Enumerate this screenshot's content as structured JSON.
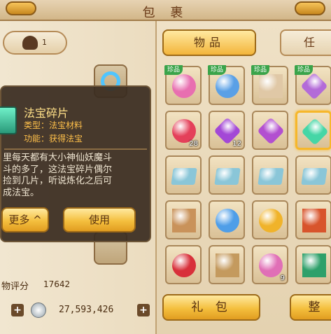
{
  "header": {
    "title": "包 裹"
  },
  "left": {
    "char_level": "1",
    "score_label": "物评分",
    "score_value": "17642",
    "money": "27,593,426",
    "plus_symbol": "+"
  },
  "tooltip": {
    "name": "法宝碎片",
    "type": "类型：法宝材料",
    "function": "功能：获得法宝",
    "description_lines": [
      "里每天都有大小神仙妖魔斗",
      "斗的多了，这法宝碎片偶尔",
      "捡到几片，听说炼化之后可",
      "成法宝。"
    ],
    "more_button": "更多 ^",
    "use_button": "使用"
  },
  "right": {
    "tabs": [
      {
        "label": "物品"
      },
      {
        "label": "任"
      }
    ],
    "rare_badge": "珍品",
    "items": [
      {
        "icon": "flower-wreath",
        "color": "#e86fb0",
        "rare": true,
        "count": ""
      },
      {
        "icon": "blue-necklace",
        "color": "#5aa0e6",
        "rare": true,
        "count": ""
      },
      {
        "icon": "shell-charm",
        "color": "#e0c8a6",
        "rare": true,
        "count": ""
      },
      {
        "icon": "purple-lotus",
        "color": "#b36bd8",
        "rare": true,
        "count": ""
      },
      {
        "icon": "red-orb",
        "color": "#e4405a",
        "rare": false,
        "count": "28"
      },
      {
        "icon": "purple-crystal",
        "color": "#a348d6",
        "rare": false,
        "count": "12"
      },
      {
        "icon": "purple-crystal",
        "color": "#b24fd0",
        "rare": false,
        "count": ""
      },
      {
        "icon": "treasure-fragment",
        "color": "#45d6a6",
        "rare": false,
        "count": "",
        "selected": true
      },
      {
        "icon": "blue-ticket",
        "color": "#8ac6d8",
        "rare": false,
        "count": ""
      },
      {
        "icon": "blue-ticket",
        "color": "#8ac6d8",
        "rare": false,
        "count": ""
      },
      {
        "icon": "blue-ticket",
        "color": "#8ac6d8",
        "rare": false,
        "count": ""
      },
      {
        "icon": "blue-ticket",
        "color": "#8ac6d8",
        "rare": false,
        "count": ""
      },
      {
        "icon": "scroll",
        "color": "#c9925a",
        "rare": false,
        "count": ""
      },
      {
        "icon": "crystal-ball",
        "color": "#4f9ee8",
        "rare": false,
        "count": ""
      },
      {
        "icon": "gold-coins",
        "color": "#f0b32a",
        "rare": false,
        "count": ""
      },
      {
        "icon": "red-treasure-box",
        "color": "#d8542c",
        "rare": false,
        "count": ""
      },
      {
        "icon": "red-rose",
        "color": "#d8303a",
        "rare": false,
        "count": ""
      },
      {
        "icon": "scissors-paper",
        "color": "#c49a5e",
        "rare": false,
        "count": ""
      },
      {
        "icon": "pink-hat",
        "color": "#e06fb6",
        "rare": false,
        "count": "9"
      },
      {
        "icon": "peacock-feather",
        "color": "#2ea06a",
        "rare": false,
        "count": ""
      }
    ],
    "gift_button": "礼 包",
    "sort_button": "整"
  },
  "colors": {
    "accent_gold": "#f4bf3e",
    "panel_bg": "#e9dcc3",
    "rare_green": "#3aa44a"
  }
}
